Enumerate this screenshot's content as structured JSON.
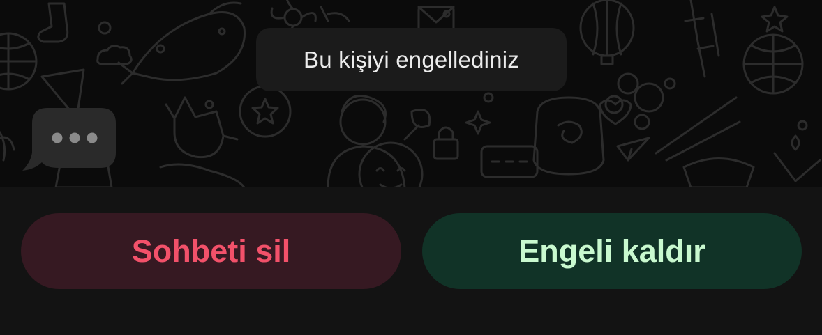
{
  "chat": {
    "system_message": "Bu kişiyi engellediniz"
  },
  "actions": {
    "delete_chat_label": "Sohbeti sil",
    "unblock_label": "Engeli kaldır"
  },
  "colors": {
    "background": "#121212",
    "system_pill": "#1b1b1b",
    "delete_bg": "#361922",
    "delete_text": "#f2516a",
    "unblock_bg": "#113327",
    "unblock_text": "#c9f9cf"
  }
}
